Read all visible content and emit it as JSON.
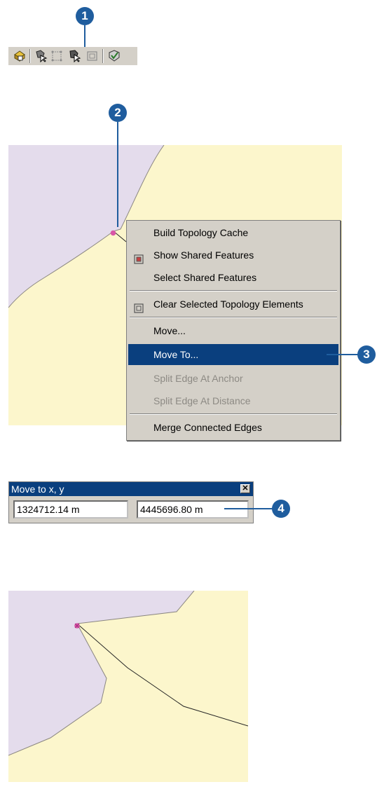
{
  "callouts": {
    "one": "1",
    "two": "2",
    "three": "3",
    "four": "4"
  },
  "toolbar": {
    "buttons": [
      {
        "icon": "topology-cache-icon"
      },
      {
        "icon": "topology-edit-tool-icon"
      },
      {
        "icon": "show-shared-features-icon"
      },
      {
        "icon": "select-shared-features-icon"
      },
      {
        "icon": "clear-topology-elements-icon"
      },
      {
        "icon": "validate-topology-icon"
      }
    ]
  },
  "context_menu": {
    "items": [
      {
        "label": "Build Topology Cache",
        "enabled": true
      },
      {
        "label": "Show Shared Features",
        "enabled": true,
        "icon": "shared-features-icon"
      },
      {
        "label": "Select Shared Features",
        "enabled": true
      },
      {
        "label": "Clear Selected Topology Elements",
        "enabled": true,
        "icon": "clear-elements-icon"
      },
      {
        "label": "Move...",
        "enabled": true
      },
      {
        "label": "Move To...",
        "enabled": true,
        "selected": true
      },
      {
        "label": "Split Edge At Anchor",
        "enabled": false
      },
      {
        "label": "Split Edge At Distance",
        "enabled": false
      },
      {
        "label": "Merge Connected Edges",
        "enabled": true
      }
    ]
  },
  "move_dialog": {
    "title": "Move to x, y",
    "x_value": "1324712.14 m",
    "y_value": "4445696.80 m",
    "close_symbol": "✕"
  },
  "colors": {
    "polygon_a": "#e4dcec",
    "polygon_b": "#fcf6cc",
    "vertex": "#d956a6",
    "callout": "#1f5d9e",
    "menu_highlight": "#0a3f7e"
  }
}
